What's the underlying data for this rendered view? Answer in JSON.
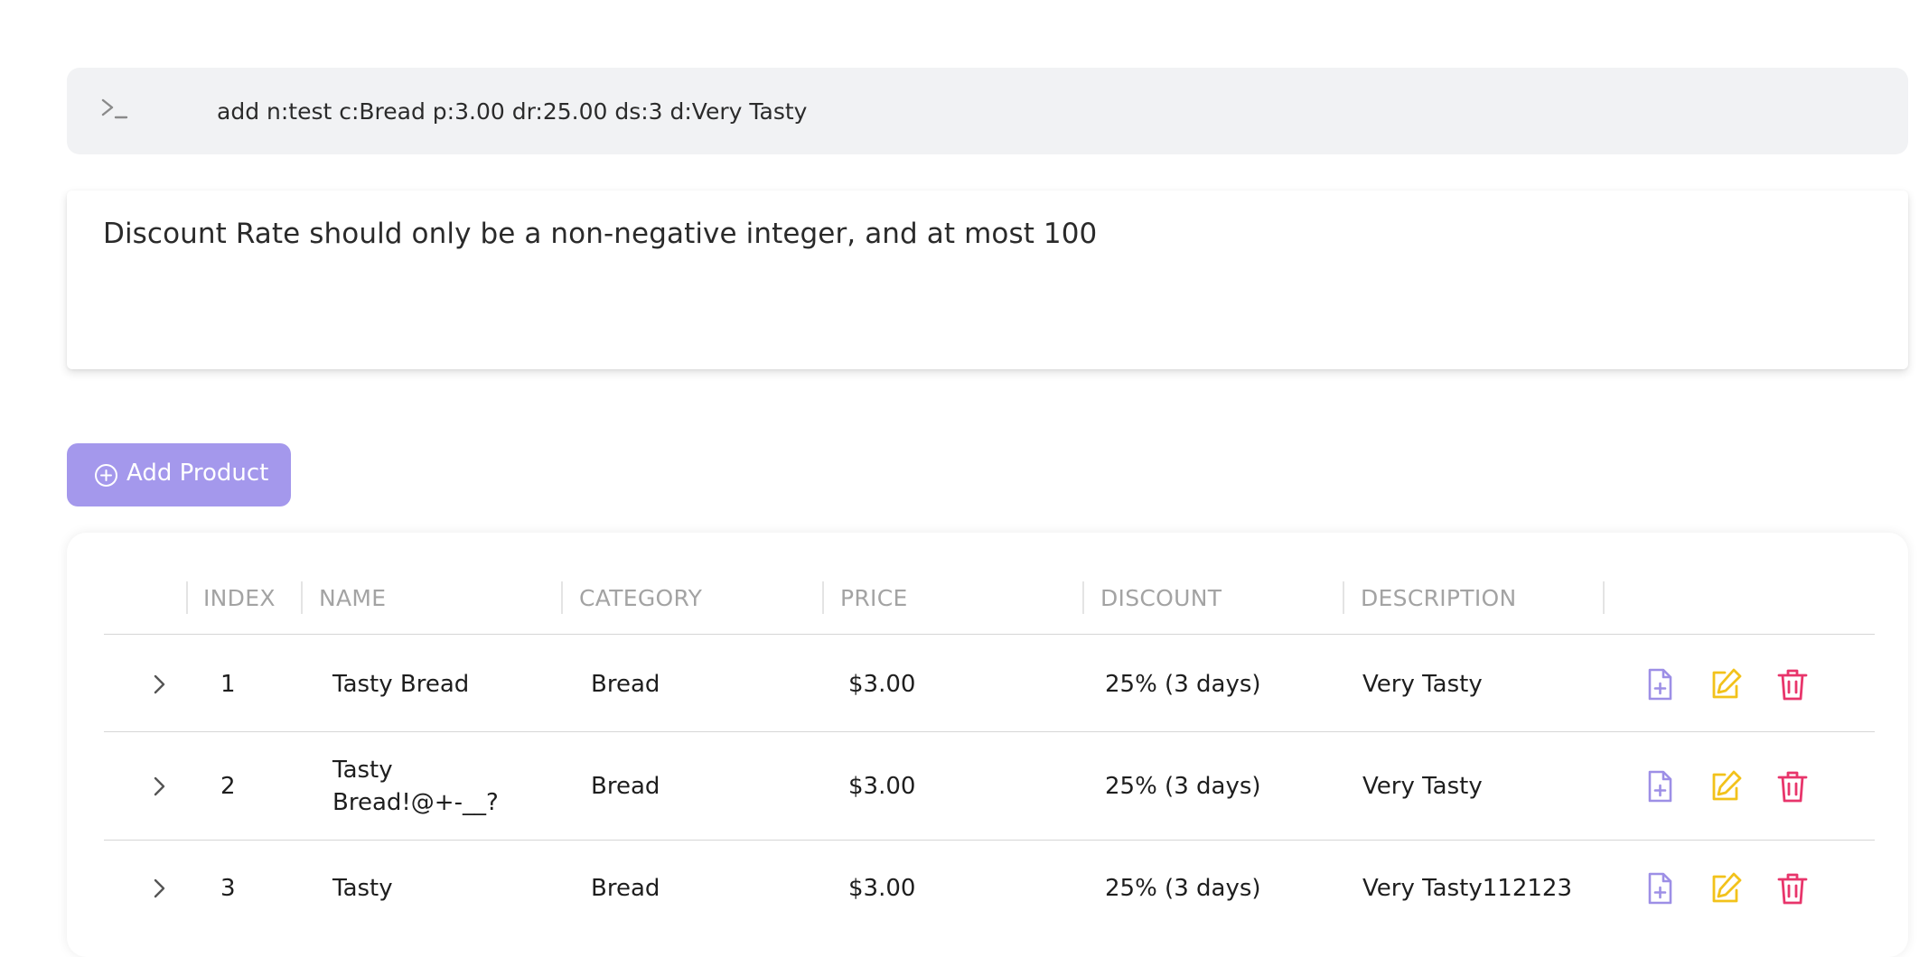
{
  "command": {
    "value": "add n:test c:Bread p:3.00 dr:25.00 ds:3 d:Very Tasty",
    "icon": "terminal-icon"
  },
  "result": {
    "message": "Discount Rate should only be a non-negative integer, and at most 100"
  },
  "toolbar": {
    "add_label": "Add Product",
    "accent": "#a498ec"
  },
  "table": {
    "headers": {
      "index": "INDEX",
      "name": "NAME",
      "category": "CATEGORY",
      "price": "PRICE",
      "discount": "DISCOUNT",
      "description": "DESCRIPTION"
    },
    "rows": [
      {
        "index": "1",
        "name_lines": [
          "Tasty Bread"
        ],
        "category": "Bread",
        "price": "$3.00",
        "discount": "25% (3 days)",
        "description": "Very Tasty"
      },
      {
        "index": "2",
        "name_lines": [
          "Tasty",
          "Bread!@+-__?"
        ],
        "category": "Bread",
        "price": "$3.00",
        "discount": "25% (3 days)",
        "description": "Very Tasty"
      },
      {
        "index": "3",
        "name_lines": [
          "Tasty"
        ],
        "category": "Bread",
        "price": "$3.00",
        "discount": "25% (3 days)",
        "description": "Very Tasty112123"
      }
    ],
    "action_colors": {
      "add_file": "#9d8fe6",
      "edit": "#f2c21b",
      "delete": "#e8356b"
    }
  }
}
